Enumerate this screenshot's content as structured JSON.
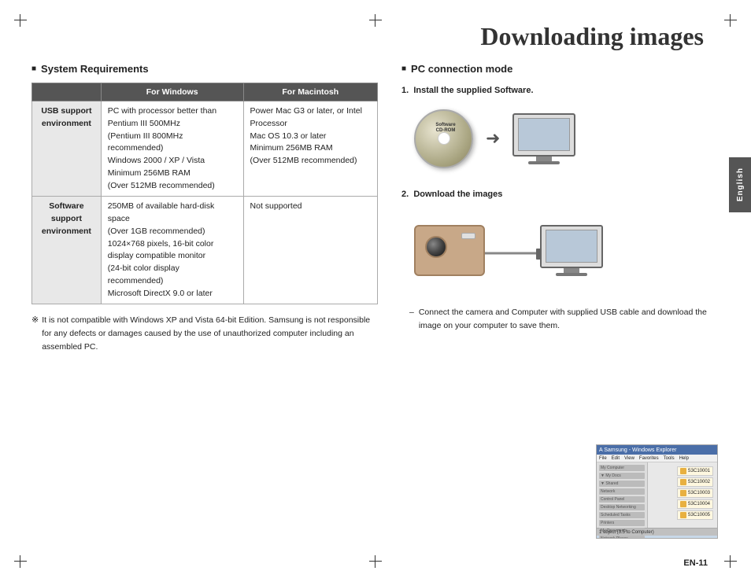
{
  "page": {
    "title": "Downloading images",
    "page_number": "EN-11"
  },
  "left_section": {
    "title": "System Requirements",
    "table": {
      "col_headers": [
        "",
        "For Windows",
        "For Macintosh"
      ],
      "rows": [
        {
          "header": "USB support environment",
          "windows": "PC with processor better than Pentium III 500MHz\n(Pentium III 800MHz recommended)\nWindows 2000 / XP / Vista\nMinimum 256MB RAM\n(Over 512MB recommended)",
          "mac": "Power Mac G3 or later, or Intel Processor\nMac OS 10.3 or later\nMinimum 256MB RAM\n(Over 512MB recommended)"
        },
        {
          "header": "Software support environment",
          "windows": "250MB of available hard-disk space\n(Over 1GB recommended)\n1024×768 pixels, 16-bit color display compatible monitor\n(24-bit color display recommended)\nMicrosoft DirectX 9.0 or later",
          "mac": "Not supported"
        }
      ]
    },
    "note": "It is not compatible with Windows XP and Vista 64-bit Edition. Samsung is not responsible for any defects or damages caused by the use of unauthorized computer including an assembled PC."
  },
  "right_section": {
    "title": "PC connection mode",
    "step1_label": "1.",
    "step1_text": "Install the supplied Software.",
    "step2_label": "2.",
    "step2_text": "Download the images",
    "connect_desc": "Connect the camera and Computer with supplied USB cable and download the image on your computer to save them.",
    "cd_label": "Software CD-ROM",
    "file_items": [
      "S3C10001",
      "S3C10002",
      "S3C10003",
      "S3C10004",
      "S3C10005"
    ],
    "thumb_title": "A Samsung - Windows Explorer",
    "thumb_status": "1 object  (3.5 to Computer)"
  },
  "english_tab": "English"
}
